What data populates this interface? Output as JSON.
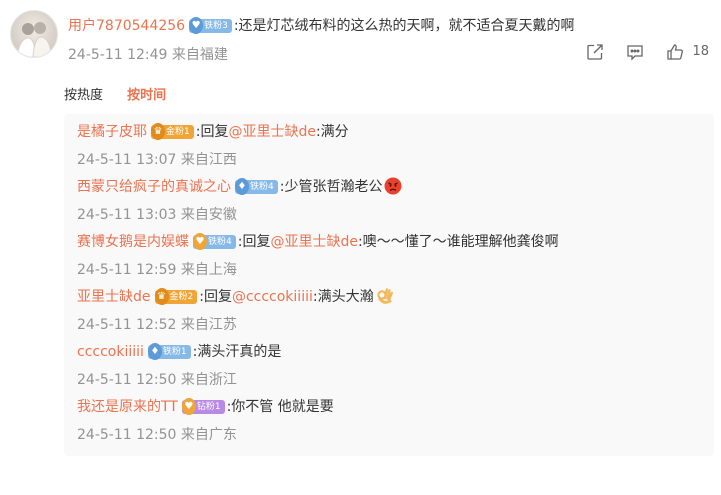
{
  "top": {
    "username": "用户7870544256",
    "badge": "铁粉3",
    "text": ":还是灯芯绒布料的这么热的天啊，就不适合夏天戴的啊",
    "time": "24-5-11 12:49",
    "location": "来自福建",
    "like_count": "18",
    "icons": [
      "share-icon",
      "comment-icon",
      "like-icon"
    ]
  },
  "sort": {
    "hot": "按热度",
    "time": "按时间"
  },
  "replies": [
    {
      "username": "是橘子皮耶",
      "badge": "金粉1",
      "badge_type": "gold",
      "prefix": ":回复",
      "mention": "@亚里士缺de",
      "text": ":满分",
      "time": "24-5-11 13:07",
      "location": "来自江西"
    },
    {
      "username": "西蒙只给疯子的真诚之心",
      "badge": "铁粉4",
      "badge_type": "iron",
      "prefix": "",
      "mention": "",
      "text": ":少管张哲瀚老公",
      "emoji": "angry-face-emoji",
      "time": "24-5-11 13:03",
      "location": "来自安徽"
    },
    {
      "username": "赛博女鹅是内娱蝶",
      "badge": "铁粉4",
      "badge_type": "iron",
      "prefix": ":回复",
      "mention": "@亚里士缺de",
      "text": ":噢～～懂了～谁能理解他龚俊啊",
      "time": "24-5-11 12:59",
      "location": "来自上海"
    },
    {
      "username": "亚里士缺de",
      "badge": "金粉2",
      "badge_type": "gold",
      "prefix": ":回复",
      "mention": "@ccccokiiiii",
      "text": ":满头大瀚",
      "emoji": "ok-hand-emoji",
      "time": "24-5-11 12:52",
      "location": "来自江苏"
    },
    {
      "username": "ccccokiiiii",
      "badge": "铁粉1",
      "badge_type": "iron",
      "prefix": "",
      "mention": "",
      "text": ":满头汗真的是",
      "time": "24-5-11 12:50",
      "location": "来自浙江"
    },
    {
      "username": "我还是原来的TT",
      "badge": "钻粉1",
      "badge_type": "drill",
      "prefix": "",
      "mention": "",
      "text": ":你不管 他就是要",
      "time": "24-5-11 12:50",
      "location": "来自广东"
    }
  ],
  "colors": {
    "accent": "#eb7350",
    "meta": "#939393",
    "reply_bg": "#f9f9f9"
  }
}
